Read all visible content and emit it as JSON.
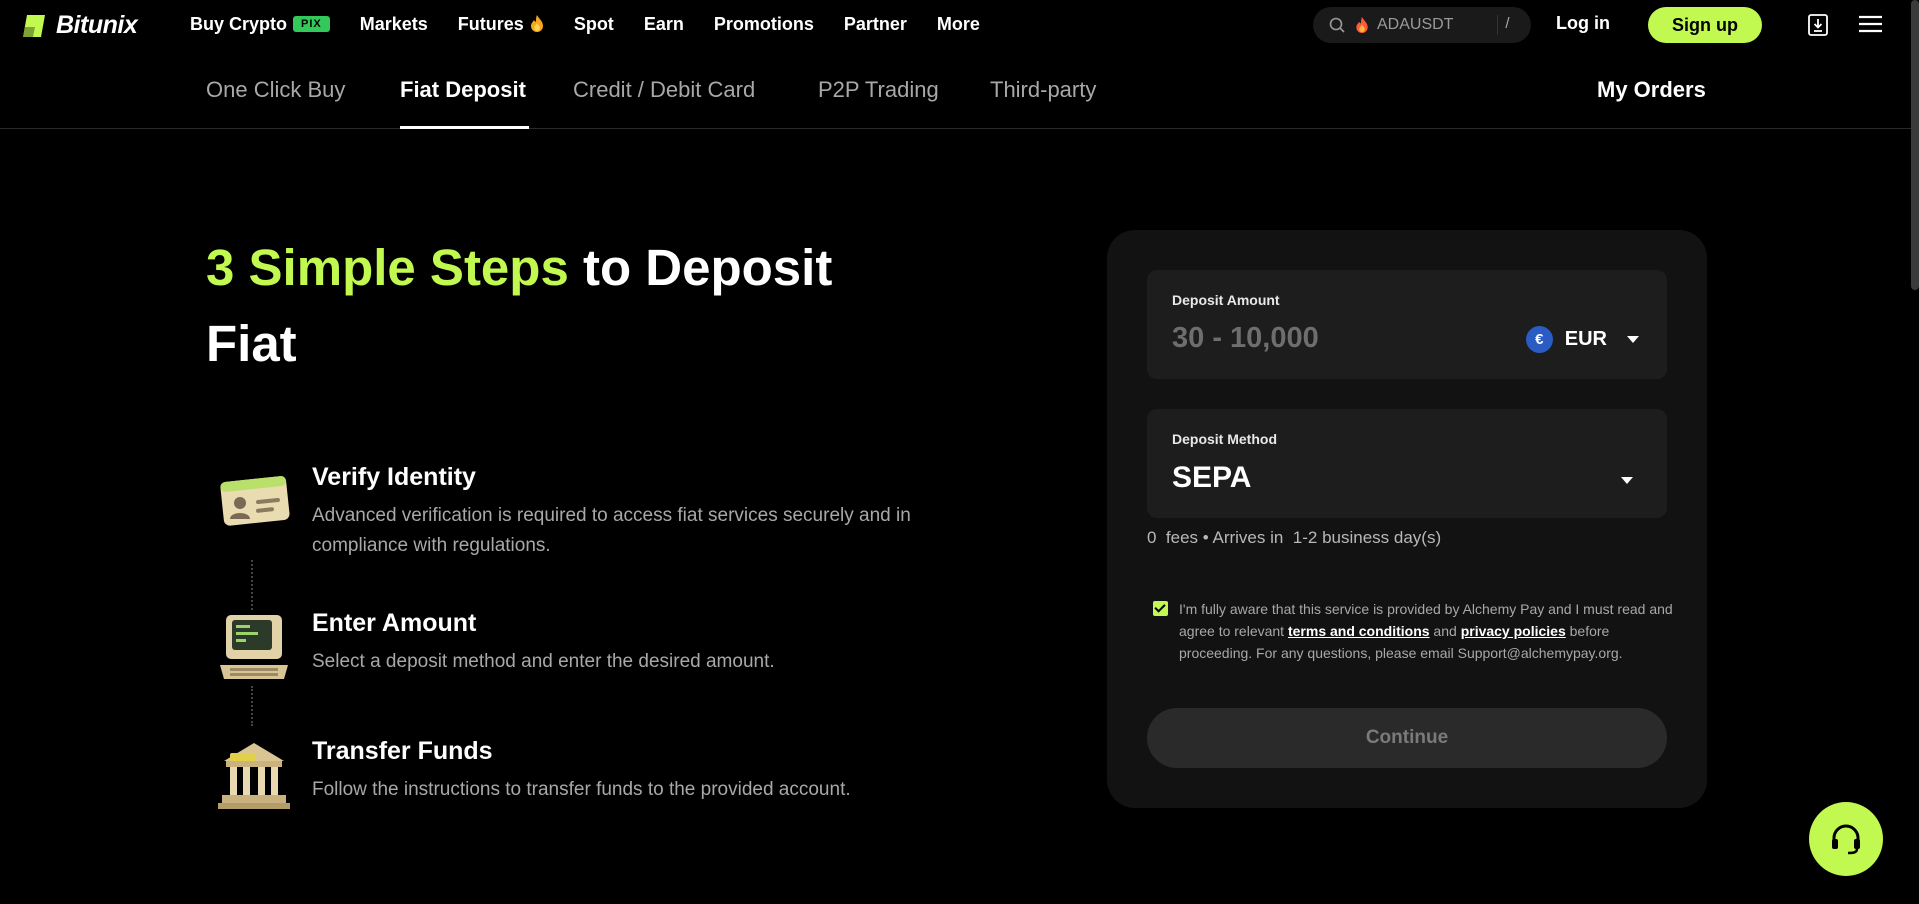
{
  "brand": {
    "name": "Bitunix",
    "accent": "#c2f950"
  },
  "nav": {
    "items": [
      {
        "label": "Buy Crypto",
        "badge": "PIX"
      },
      {
        "label": "Markets"
      },
      {
        "label": "Futures"
      },
      {
        "label": "Spot"
      },
      {
        "label": "Earn"
      },
      {
        "label": "Promotions"
      },
      {
        "label": "Partner"
      },
      {
        "label": "More"
      }
    ],
    "search_value": "ADAUSDT",
    "search_shortcut": "/",
    "login_label": "Log in",
    "signup_label": "Sign up"
  },
  "tabs": {
    "items": [
      "One Click Buy",
      "Fiat Deposit",
      "Credit / Debit Card",
      "P2P Trading",
      "Third-party"
    ],
    "active": "Fiat Deposit",
    "my_orders": "My Orders"
  },
  "headline": {
    "accent": "3 Simple Steps",
    "rest": " to Deposit Fiat"
  },
  "steps": [
    {
      "title": "Verify Identity",
      "desc": "Advanced verification is required to access fiat services securely and in compliance with regulations.",
      "icon": "id-card-icon"
    },
    {
      "title": "Enter Amount",
      "desc": "Select a deposit method and enter the desired amount.",
      "icon": "computer-icon"
    },
    {
      "title": "Transfer Funds",
      "desc": "Follow the instructions to transfer funds to the provided account.",
      "icon": "bank-icon"
    }
  ],
  "card": {
    "amount_label": "Deposit Amount",
    "amount_placeholder": "30 - 10,000",
    "currency": "EUR",
    "currency_symbol": "€",
    "method_label": "Deposit Method",
    "method_value": "SEPA",
    "fee_line": "0  fees • Arrives in  1-2 business day(s)",
    "agree_prefix": "I'm fully aware that this service is provided by Alchemy Pay and I must read and agree to relevant ",
    "terms_link": "terms and conditions",
    "agree_and": " and ",
    "privacy_link": "privacy policies",
    "agree_suffix": " before proceeding. For any questions, please email Support@alchemypay.org.",
    "agree_checked": true,
    "continue_label": "Continue"
  }
}
